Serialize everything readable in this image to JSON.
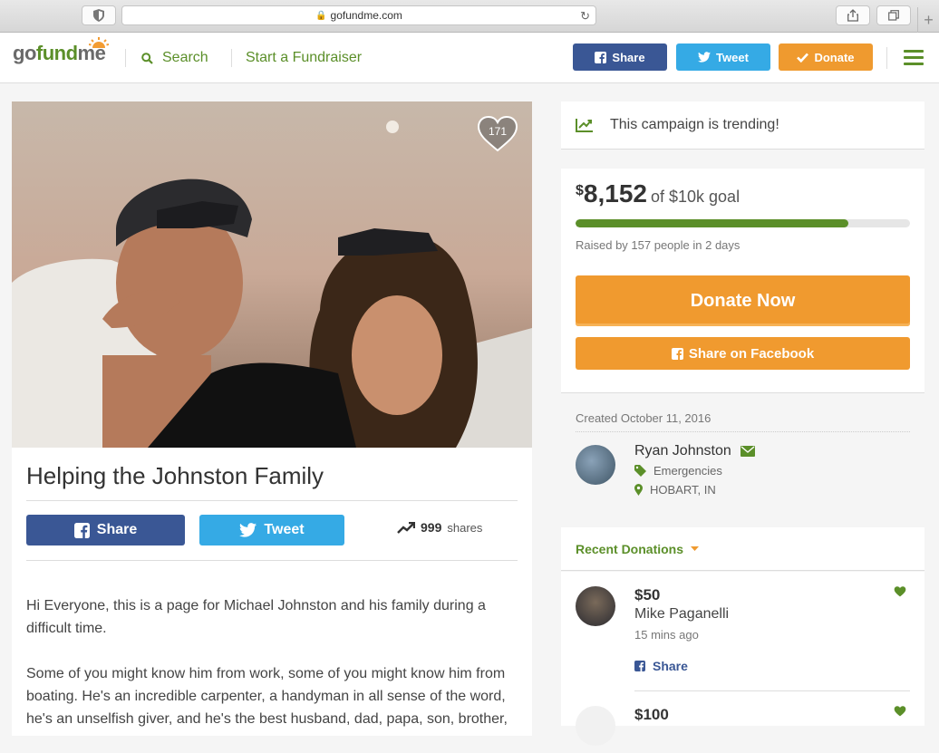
{
  "browser": {
    "url": "gofundme.com"
  },
  "header": {
    "logo_go": "go",
    "logo_fund": "fund",
    "logo_me": "me",
    "search_label": "Search",
    "start_label": "Start a Fundraiser",
    "share_label": "Share",
    "tweet_label": "Tweet",
    "donate_label": "Donate"
  },
  "campaign": {
    "hearts": "171",
    "title": "Helping the Johnston Family",
    "share_label": "Share",
    "tweet_label": "Tweet",
    "shares_count": "999",
    "shares_label": "shares",
    "story": [
      "Hi Everyone, this is a page for Michael Johnston and his family during a difficult time.",
      "Some of you might know him from work, some of you might know him from boating. He's an incredible carpenter, a handyman in all sense of the word, he's an unselfish giver, and he's the best husband, dad, papa, son, brother,"
    ]
  },
  "sidebar": {
    "trending_text": "This campaign is trending!",
    "currency": "$",
    "raised_amount": "8,152",
    "goal_text": "of $10k goal",
    "progress_percent": 81.5,
    "raised_by": "Raised by 157 people in 2 days",
    "donate_now_label": "Donate Now",
    "share_facebook_label": "Share on Facebook",
    "created": "Created October 11, 2016",
    "organizer_name": "Ryan Johnston",
    "category": "Emergencies",
    "location": "HOBART, IN",
    "recent_donations_label": "Recent Donations",
    "donations": [
      {
        "amount": "$50",
        "name": "Mike Paganelli",
        "time": "15 mins ago",
        "share_label": "Share"
      },
      {
        "amount": "$100",
        "name": "",
        "time": "",
        "share_label": ""
      }
    ]
  },
  "colors": {
    "brand_green": "#5b8f29",
    "facebook_blue": "#3a5795",
    "twitter_blue": "#35aae5",
    "donate_orange": "#f09a2f"
  }
}
